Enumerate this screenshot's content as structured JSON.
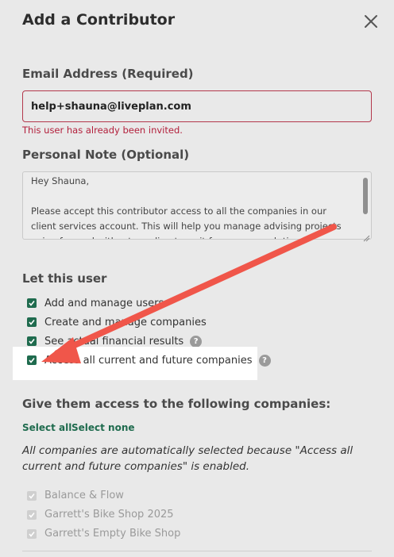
{
  "dialog": {
    "title": "Add a Contributor",
    "close_icon": "close-icon"
  },
  "email": {
    "label": "Email Address (Required)",
    "value": "help+shauna@liveplan.com",
    "error": "This user has already been invited."
  },
  "note": {
    "label": "Personal Note (Optional)",
    "lines": [
      "Hey Shauna,",
      "Please accept this contributor access to all the companies in our client services account. This will help you manage advising projects going forward without needing to wait for access each time!"
    ]
  },
  "permissions": {
    "label": "Let this user",
    "items": [
      {
        "label": "Add and manage users",
        "checked": true
      },
      {
        "label": "Create and manage companies",
        "checked": true
      },
      {
        "label": "See actual financial results",
        "checked": true,
        "help_icon": "question-icon"
      },
      {
        "label": "Access all current and future companies",
        "checked": true,
        "help_icon": "question-icon"
      }
    ]
  },
  "companies": {
    "label": "Give them access to the following companies:",
    "select_all": "Select all",
    "select_none": "Select none",
    "info": "All companies are automatically selected because \"Access all current and future companies\" is enabled.",
    "items": [
      {
        "label": "Balance & Flow",
        "checked": true,
        "disabled": true
      },
      {
        "label": "Garrett's Bike Shop 2025",
        "checked": true,
        "disabled": true
      },
      {
        "label": "Garrett's Empty Bike Shop",
        "checked": true,
        "disabled": true
      }
    ]
  },
  "annotation": {
    "arrow_color": "#f0564a",
    "highlight_color": "#ffffff"
  },
  "colors": {
    "accent": "#1f6b4e",
    "error": "#b3203c"
  }
}
